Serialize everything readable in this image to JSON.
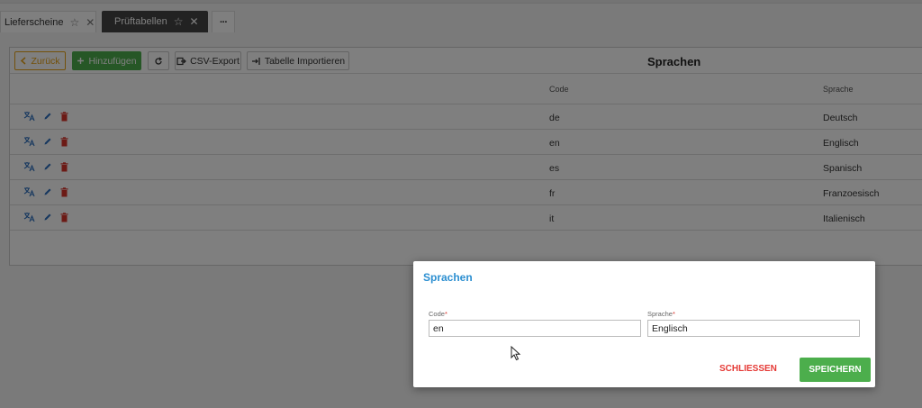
{
  "tabs": [
    {
      "label": "Lieferscheine"
    },
    {
      "label": "Prüftabellen"
    },
    {
      "label": "···"
    }
  ],
  "toolbar": {
    "back_label": "Zurück",
    "add_label": "Hinzufügen",
    "csv_label": "CSV-Export",
    "import_label": "Tabelle Importieren",
    "title": "Sprachen"
  },
  "table": {
    "headers": {
      "code": "Code",
      "language": "Sprache"
    },
    "rows": [
      {
        "code": "de",
        "language": "Deutsch"
      },
      {
        "code": "en",
        "language": "Englisch"
      },
      {
        "code": "es",
        "language": "Spanisch"
      },
      {
        "code": "fr",
        "language": "Franzoesisch"
      },
      {
        "code": "it",
        "language": "Italienisch"
      }
    ]
  },
  "dialog": {
    "title": "Sprachen",
    "code_label": "Code",
    "code_value": "en",
    "language_label": "Sprache",
    "language_value": "Englisch",
    "required_mark": "*",
    "close_label": "SCHLIESSEN",
    "save_label": "SPEICHERN"
  },
  "icons": [
    "star-icon",
    "close-icon",
    "chevron-left-icon",
    "plus-icon",
    "refresh-icon",
    "export-icon",
    "import-icon",
    "translate-icon",
    "edit-icon",
    "trash-icon",
    "mouse-cursor-icon"
  ],
  "colors": {
    "accent_green": "#4cae4c",
    "accent_orange": "#e6a217",
    "dialog_title": "#2c8fd1",
    "danger": "#e53935"
  }
}
